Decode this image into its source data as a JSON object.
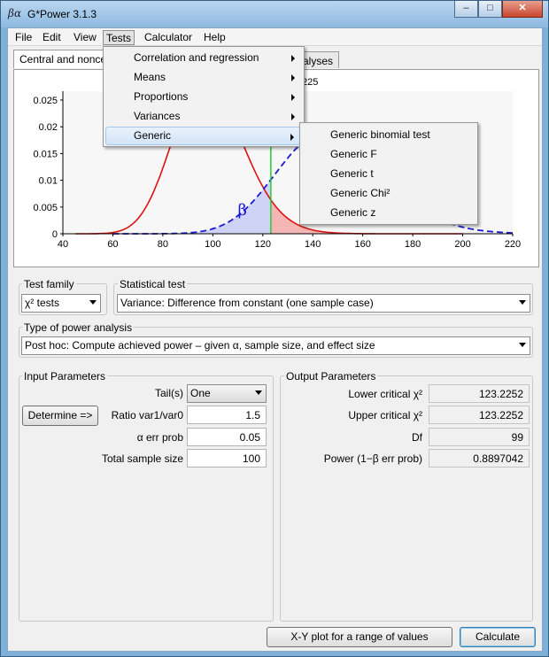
{
  "window": {
    "title": "G*Power 3.1.3",
    "icon_text": "βα",
    "min": "‒",
    "max": "□",
    "close": "✕"
  },
  "menubar": [
    "File",
    "Edit",
    "View",
    "Tests",
    "Calculator",
    "Help"
  ],
  "tabs": {
    "active": "Central and noncentral distributions",
    "inactive": "Protocol of power analyses",
    "inactive_visible": "alyses"
  },
  "plot": {
    "header_value": "225",
    "y_ticks": [
      "0.025",
      "0.02",
      "0.015",
      "0.01",
      "0.005",
      "0"
    ],
    "x_ticks": [
      "40",
      "60",
      "80",
      "100",
      "120",
      "140",
      "160",
      "180",
      "200",
      "220"
    ],
    "beta_symbol": "β",
    "critical_value": 123.2252,
    "colors": {
      "null_dist": "#dd1111",
      "alt_dist": "#1a1ad4",
      "critical": "#22cc33",
      "beta_fill": "#cfd3f5",
      "alpha_fill": "#f5b5b5"
    }
  },
  "tests_menu": {
    "items": [
      {
        "label": "Correlation and regression",
        "submenu": true
      },
      {
        "label": "Means",
        "submenu": true
      },
      {
        "label": "Proportions",
        "submenu": true
      },
      {
        "label": "Variances",
        "submenu": true
      },
      {
        "label": "Generic",
        "submenu": true,
        "highlighted": true
      }
    ]
  },
  "generic_menu": {
    "items": [
      "Generic binomial test",
      "Generic F",
      "Generic t",
      "Generic Chi²",
      "Generic z"
    ]
  },
  "test_family": {
    "label": "Test family",
    "value": "χ² tests"
  },
  "statistical_test": {
    "label": "Statistical test",
    "value": "Variance: Difference from constant (one sample case)"
  },
  "power_analysis": {
    "label": "Type of power analysis",
    "value": "Post hoc: Compute achieved power – given α, sample size, and effect size"
  },
  "input": {
    "title": "Input Parameters",
    "tails_label": "Tail(s)",
    "tails_value": "One",
    "determine": "Determine =>",
    "ratio_label": "Ratio var1/var0",
    "ratio_value": "1.5",
    "alpha_label": "α err prob",
    "alpha_value": "0.05",
    "n_label": "Total sample size",
    "n_value": "100"
  },
  "output": {
    "title": "Output Parameters",
    "lower_label": "Lower critical χ²",
    "lower_value": "123.2252",
    "upper_label": "Upper critical χ²",
    "upper_value": "123.2252",
    "df_label": "Df",
    "df_value": "99",
    "power_label": "Power (1−β err prob)",
    "power_value": "0.8897042"
  },
  "buttons": {
    "xy_plot": "X-Y plot for a range of values",
    "calculate": "Calculate"
  }
}
